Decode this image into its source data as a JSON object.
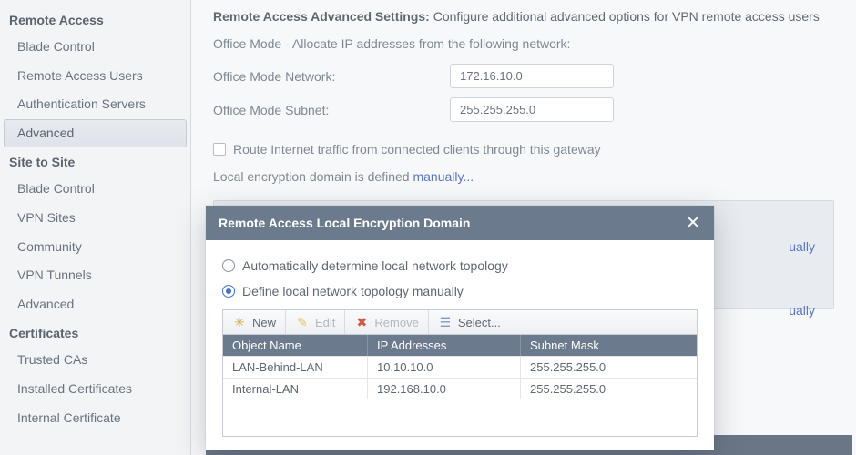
{
  "sidebar": {
    "groups": [
      {
        "title": "Remote Access",
        "items": [
          {
            "label": "Blade Control",
            "active": false
          },
          {
            "label": "Remote Access Users",
            "active": false
          },
          {
            "label": "Authentication Servers",
            "active": false
          },
          {
            "label": "Advanced",
            "active": true
          }
        ]
      },
      {
        "title": "Site to Site",
        "items": [
          {
            "label": "Blade Control",
            "active": false
          },
          {
            "label": "VPN Sites",
            "active": false
          },
          {
            "label": "Community",
            "active": false
          },
          {
            "label": "VPN Tunnels",
            "active": false
          },
          {
            "label": "Advanced",
            "active": false
          }
        ]
      },
      {
        "title": "Certificates",
        "items": [
          {
            "label": "Trusted CAs",
            "active": false
          },
          {
            "label": "Installed Certificates",
            "active": false
          },
          {
            "label": "Internal Certificate",
            "active": false
          }
        ]
      }
    ]
  },
  "main": {
    "heading_bold": "Remote Access Advanced Settings:",
    "heading_rest": " Configure additional advanced options for VPN remote access users",
    "office_mode_line": "Office Mode - Allocate IP addresses from the following network:",
    "office_network_label": "Office Mode Network:",
    "office_network_value": "172.16.10.0",
    "office_subnet_label": "Office Mode Subnet:",
    "office_subnet_value": "255.255.255.0",
    "route_check_label": "Route Internet traffic from connected clients through this gateway",
    "local_enc_prefix": "Local encryption domain is defined ",
    "local_enc_link": "manually...",
    "bg_line1_suffix": "ually",
    "bg_line2_suffix": "ually"
  },
  "modal": {
    "title": "Remote Access Local Encryption Domain",
    "radio_auto": "Automatically determine local network topology",
    "radio_manual": "Define local network topology manually",
    "toolbar": {
      "new": "New",
      "edit": "Edit",
      "remove": "Remove",
      "select": "Select..."
    },
    "columns": {
      "c1": "Object Name",
      "c2": "IP Addresses",
      "c3": "Subnet Mask"
    },
    "rows": [
      {
        "name": "LAN-Behind-LAN",
        "ip": "10.10.10.0",
        "mask": "255.255.255.0"
      },
      {
        "name": "Internal-LAN",
        "ip": "192.168.10.0",
        "mask": "255.255.255.0"
      }
    ]
  }
}
